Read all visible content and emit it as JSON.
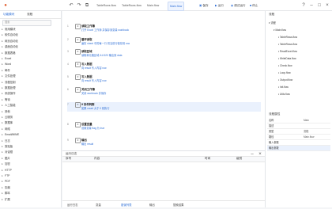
{
  "topbar": {
    "icons": [
      "undo-icon",
      "redo-icon",
      "copy-icon"
    ],
    "tabs": [
      "TableRows.flow",
      "TableRows.flow",
      "Main.flow",
      "Main.flow"
    ],
    "active_tab_index": 3,
    "buttons": [
      {
        "icon": "save-icon",
        "label": "保存"
      },
      {
        "icon": "run-icon",
        "label": "运行"
      },
      {
        "icon": "debug-icon",
        "label": "调试运行"
      },
      {
        "icon": "stop-icon",
        "label": "停止"
      }
    ],
    "right_icons": [
      "help-icon",
      "min-icon",
      "max-icon",
      "close-icon"
    ]
  },
  "leftbar": {
    "tabs": [
      "功能模块",
      "流程"
    ],
    "search_placeholder": "搜索",
    "items": [
      {
        "icon": "folder-icon",
        "label": "常用模块"
      },
      {
        "icon": "folder-icon",
        "label": "软件自动化"
      },
      {
        "icon": "folder-icon",
        "label": "网页自动化"
      },
      {
        "icon": "folder-icon",
        "label": "桌面自动化"
      },
      {
        "icon": "folder-icon",
        "label": "数据表格"
      },
      {
        "icon": "folder-icon",
        "label": "Excel"
      },
      {
        "icon": "folder-icon",
        "label": "Word"
      },
      {
        "icon": "folder-icon",
        "label": "邮件"
      },
      {
        "icon": "folder-icon",
        "label": "文件处理"
      },
      {
        "icon": "folder-icon",
        "label": "流程控制"
      },
      {
        "icon": "folder-icon",
        "label": "数据处理"
      },
      {
        "icon": "folder-icon",
        "label": "系统操作"
      },
      {
        "icon": "folder-icon",
        "label": "等待"
      },
      {
        "icon": "folder-icon",
        "label": "人工智能"
      },
      {
        "icon": "folder-icon",
        "label": "其他"
      },
      {
        "icon": "folder-icon",
        "label": "云服务"
      },
      {
        "icon": "folder-icon",
        "label": "数据库"
      },
      {
        "icon": "folder-icon",
        "label": "网络"
      },
      {
        "icon": "folder-icon",
        "label": "Email/MIME"
      },
      {
        "icon": "folder-icon",
        "label": "日志"
      },
      {
        "icon": "folder-icon",
        "label": "剪贴板"
      },
      {
        "icon": "folder-icon",
        "label": "对话框"
      },
      {
        "icon": "folder-icon",
        "label": "图片"
      },
      {
        "icon": "folder-icon",
        "label": "加密"
      },
      {
        "icon": "folder-icon",
        "label": "HTTP"
      },
      {
        "icon": "folder-icon",
        "label": "FTP"
      },
      {
        "icon": "folder-icon",
        "label": "PDF"
      },
      {
        "icon": "folder-icon",
        "label": "压缩"
      },
      {
        "icon": "folder-icon",
        "label": "脚本"
      },
      {
        "icon": "folder-icon",
        "label": "扩展"
      }
    ]
  },
  "center": {
    "rows": [
      {
        "num": "1",
        "title": "读取工作簿",
        "line": "打开 Excel 工作簿 并保存到变量 workbook"
      },
      {
        "num": "2",
        "title": "循环读取",
        "line": "遍历 sheet 中的每一行 将当前行保存到 row"
      },
      {
        "num": "3",
        "title": "读取区域",
        "line": "读取单元格区域 A1:D20 输出到 data"
      },
      {
        "num": "4",
        "title": "写入数据",
        "line": "向 result 写入内容 row"
      },
      {
        "num": "5",
        "title": "写入数据",
        "line": "向 result 写入内容 row"
      },
      {
        "num": "6",
        "title": "关闭工作簿",
        "line": "关闭 workbook 并保存"
      },
      {
        "num": "7",
        "title": "If 条件判断",
        "line": "如果 count 大于 0 则执行"
      },
      {
        "num": "8",
        "title": "设置变量",
        "line": "设置变量 flag 为 true"
      },
      {
        "num": "9",
        "title": "输出",
        "line": "输出 result"
      }
    ],
    "sub_label_1": "变量",
    "sub_label_2": "返回"
  },
  "bottom": {
    "title": "运行日志",
    "columns": [
      "序号",
      "内容",
      "时间",
      "级别"
    ],
    "tabs": [
      "运行日志",
      "变量",
      "错误列表",
      "输出",
      "搜索结果"
    ],
    "active_tab_index": 2
  },
  "right": {
    "header": "流程",
    "tree": [
      {
        "label": "流程",
        "depth": 0
      },
      {
        "label": "Main.flow",
        "depth": 1
      },
      {
        "label": "TableRows.flow",
        "depth": 2
      },
      {
        "label": "TableRows.flow",
        "depth": 2
      },
      {
        "label": "ReadExcel.flow",
        "depth": 2
      },
      {
        "label": "WriteData.flow",
        "depth": 2
      },
      {
        "label": "Check.flow",
        "depth": 2
      },
      {
        "label": "Loop.flow",
        "depth": 2
      },
      {
        "label": "Output.flow",
        "depth": 2
      },
      {
        "label": "Init.flow",
        "depth": 2
      },
      {
        "label": "Utils.flow",
        "depth": 2
      }
    ],
    "props_header": "流程属性",
    "props": [
      {
        "k": "名称",
        "v": "Main"
      },
      {
        "k": "描述",
        "v": ""
      },
      {
        "k": "类型",
        "v": "流程"
      },
      {
        "k": "路径",
        "v": "Main.flow"
      },
      {
        "k": "输入参数",
        "v": ""
      },
      {
        "k": "输出参数",
        "v": ""
      }
    ]
  },
  "colors": {
    "accent": "#2f6fd6",
    "selected": "#eaf1fd"
  }
}
